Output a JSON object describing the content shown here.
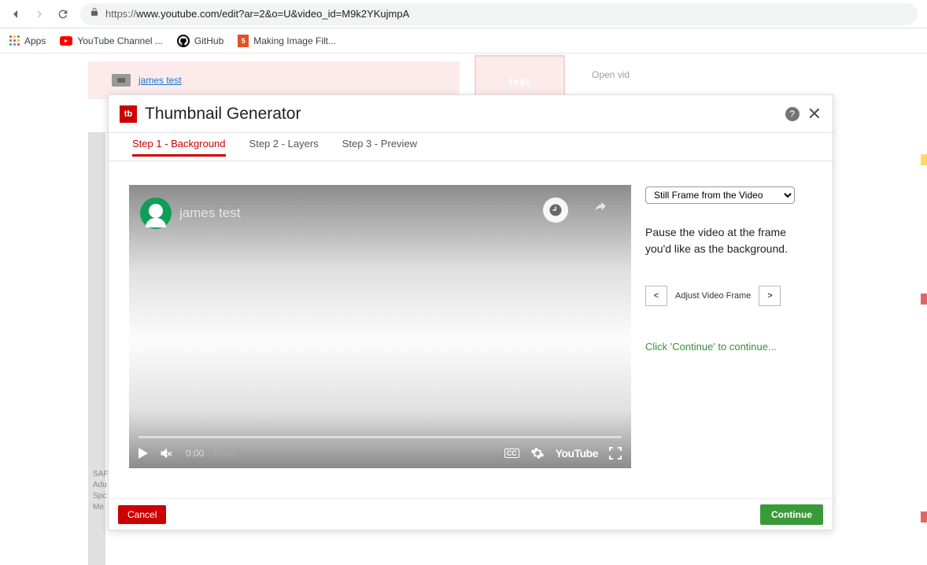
{
  "browser": {
    "url_proto": "https://",
    "url_rest": "www.youtube.com/edit?ar=2&o=U&video_id=M9k2YKujmpA"
  },
  "bookmarks": {
    "apps": "Apps",
    "yt_channel": "YouTube Channel ...",
    "github": "GitHub",
    "making_image": "Making Image Filt..."
  },
  "background": {
    "video_link": "james test",
    "test_box": "test",
    "open_vid": "Open vid",
    "sidebar_lines": "SAF\nAdu\nSpc\nMe"
  },
  "modal": {
    "logo_text": "tb",
    "title": "Thumbnail Generator",
    "tabs": {
      "step1": "Step 1 - Background",
      "step2": "Step 2 - Layers",
      "step3": "Step 3 - Preview"
    },
    "video": {
      "title": "james test",
      "current_time": "0:00",
      "duration": "11:26",
      "cc_label": "CC",
      "youtube_label": "YouTube"
    },
    "panel": {
      "source_select": "Still Frame from the Video",
      "help_text": "Pause the video at the frame you'd like as the background.",
      "adjust_label": "Adjust Video Frame",
      "prev": "<",
      "next": ">",
      "continue_hint": "Click 'Continue' to continue..."
    },
    "footer": {
      "cancel": "Cancel",
      "continue": "Continue"
    }
  }
}
